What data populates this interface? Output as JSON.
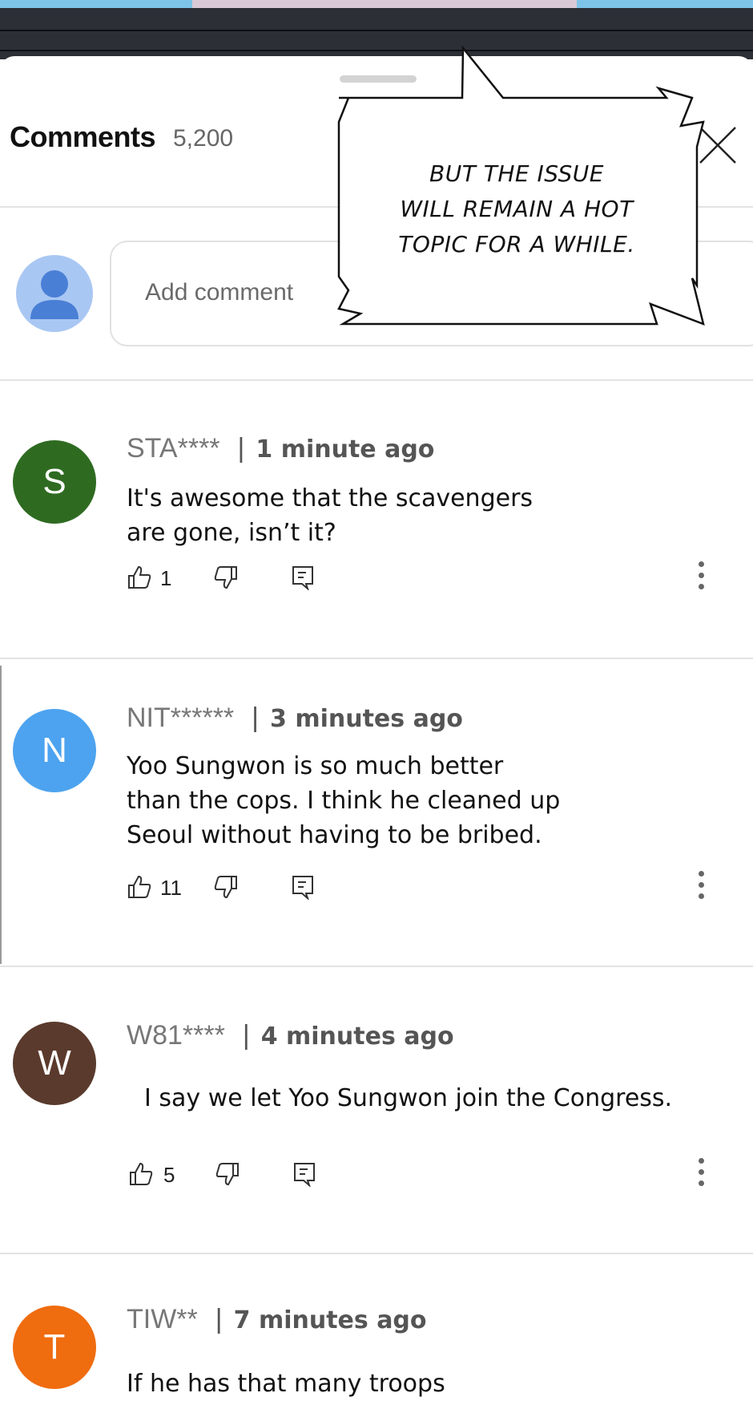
{
  "header": {
    "title": "Comments",
    "count": "5,200"
  },
  "add_comment": {
    "placeholder": "Add comment"
  },
  "speech_bubble": {
    "lines": [
      "BUT THE ISSUE",
      "WILL REMAIN A HOT",
      "TOPIC FOR A WHILE."
    ]
  },
  "comments": [
    {
      "initial": "S",
      "avatar_color": "#2e6b21",
      "user": "STA****",
      "separator": "|",
      "time": "1 minute ago",
      "text_lines": [
        "It's awesome that the scavengers",
        "are gone, isn’t it?"
      ],
      "likes": "1"
    },
    {
      "initial": "N",
      "avatar_color": "#4da3ef",
      "user": "NIT******",
      "separator": "|",
      "time": "3 minutes ago",
      "text_lines": [
        "Yoo Sungwon is so much better",
        "than the cops. I think he cleaned up",
        "Seoul without having to be bribed."
      ],
      "likes": "11"
    },
    {
      "initial": "W",
      "avatar_color": "#5a3a2c",
      "user": "W81****",
      "separator": "|",
      "time": "4 minutes ago",
      "text_lines": [
        "I say we let Yoo Sungwon join the Congress."
      ],
      "likes": "5"
    },
    {
      "initial": "T",
      "avatar_color": "#ef6c0f",
      "user": "TIW**",
      "separator": "|",
      "time": "7 minutes ago",
      "text_lines": [
        "If he has that many troops"
      ],
      "likes": ""
    }
  ],
  "icons": {
    "like": "thumbs-up-icon",
    "dislike": "thumbs-down-icon",
    "reply": "reply-icon",
    "more": "more-vertical-icon",
    "close": "close-icon"
  }
}
